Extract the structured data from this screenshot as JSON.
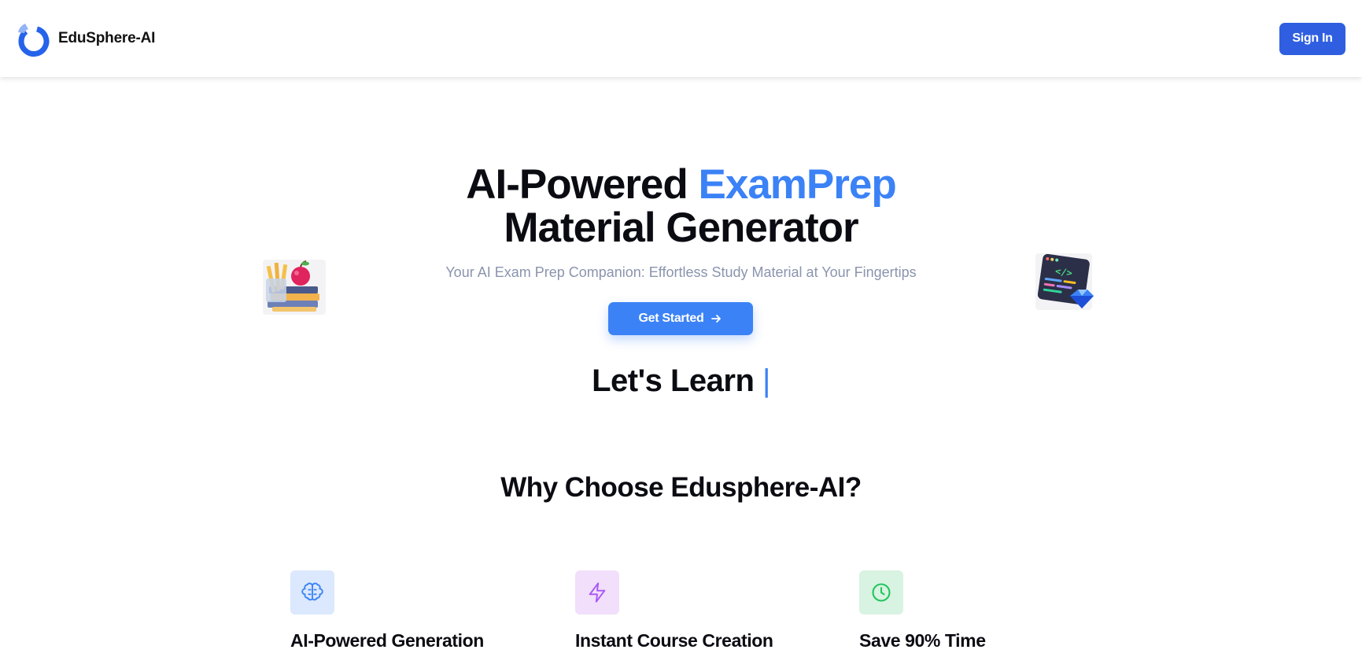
{
  "header": {
    "brand_name": "EduSphere-AI",
    "signin_label": "Sign In"
  },
  "hero": {
    "title_part1": "AI-Powered ",
    "title_accent": "ExamPrep",
    "title_part2": "Material Generator",
    "subtitle": "Your AI Exam Prep Companion: Effortless Study Material at Your Fingertips",
    "cta_label": "Get Started",
    "typing_text": "Let's Learn ",
    "typing_cursor": "|"
  },
  "why": {
    "heading": "Why Choose Edusphere-AI?",
    "features": [
      {
        "label": "AI-Powered Generation",
        "icon": "brain-icon",
        "color": "#3b82f6"
      },
      {
        "label": "Instant Course Creation",
        "icon": "lightning-icon",
        "color": "#a855f7"
      },
      {
        "label": "Save 90% Time",
        "icon": "clock-icon",
        "color": "#22c55e"
      }
    ]
  },
  "colors": {
    "accent": "#3b82f6",
    "signin_bg": "#2f5fe0",
    "subtitle": "#8a94ad"
  }
}
